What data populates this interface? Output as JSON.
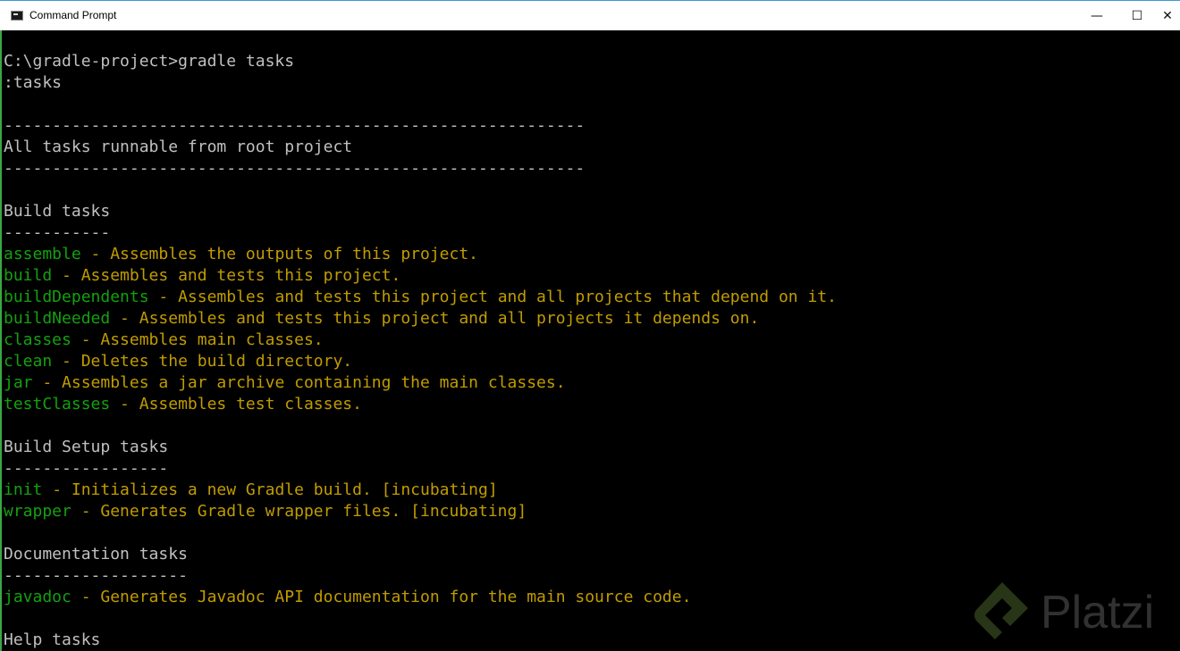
{
  "window": {
    "title": "Command Prompt",
    "minimize_glyph": "—",
    "maximize_glyph": "☐",
    "close_glyph": "✕",
    "icon": "console-icon"
  },
  "console": {
    "prompt_line": "C:\\gradle-project>gradle tasks",
    "task_line": ":tasks",
    "separator_long": "------------------------------------------------------------",
    "header": "All tasks runnable from root project",
    "groups": [
      {
        "title": "Build tasks",
        "underline": "-----------",
        "tasks": [
          {
            "name": "assemble",
            "desc": " - Assembles the outputs of this project."
          },
          {
            "name": "build",
            "desc": " - Assembles and tests this project."
          },
          {
            "name": "buildDependents",
            "desc": " - Assembles and tests this project and all projects that depend on it."
          },
          {
            "name": "buildNeeded",
            "desc": " - Assembles and tests this project and all projects it depends on."
          },
          {
            "name": "classes",
            "desc": " - Assembles main classes."
          },
          {
            "name": "clean",
            "desc": " - Deletes the build directory."
          },
          {
            "name": "jar",
            "desc": " - Assembles a jar archive containing the main classes."
          },
          {
            "name": "testClasses",
            "desc": " - Assembles test classes."
          }
        ]
      },
      {
        "title": "Build Setup tasks",
        "underline": "-----------------",
        "tasks": [
          {
            "name": "init",
            "desc": " - Initializes a new Gradle build. [incubating]"
          },
          {
            "name": "wrapper",
            "desc": " - Generates Gradle wrapper files. [incubating]"
          }
        ]
      },
      {
        "title": "Documentation tasks",
        "underline": "-------------------",
        "tasks": [
          {
            "name": "javadoc",
            "desc": " - Generates Javadoc API documentation for the main source code."
          }
        ]
      },
      {
        "title": "Help tasks",
        "underline": "",
        "tasks": []
      }
    ]
  },
  "colors": {
    "background": "#000000",
    "default_text": "#c0c0c0",
    "task_name": "#13a10e",
    "task_desc": "#c19c00"
  },
  "watermark": {
    "text": "Platzi",
    "icon": "platzi-logo-icon"
  }
}
